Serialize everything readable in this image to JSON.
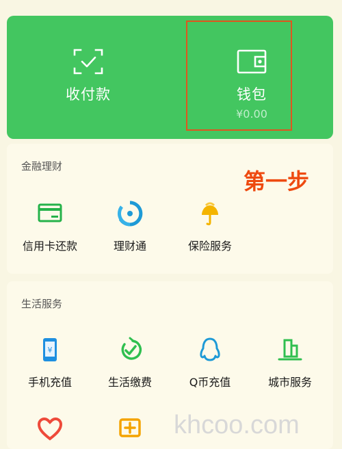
{
  "top": {
    "pay_label": "收付款",
    "wallet_label": "钱包",
    "wallet_balance": "¥0.00",
    "accent": "#43c660"
  },
  "finance": {
    "title": "金融理财",
    "step_note": "第一步",
    "items": [
      {
        "label": "信用卡还款",
        "icon": "credit-card-icon"
      },
      {
        "label": "理财通",
        "icon": "wealth-icon"
      },
      {
        "label": "保险服务",
        "icon": "insurance-umbrella-icon"
      }
    ]
  },
  "life": {
    "title": "生活服务",
    "items": [
      {
        "label": "手机充值",
        "icon": "phone-topup-icon"
      },
      {
        "label": "生活缴费",
        "icon": "utility-pay-icon"
      },
      {
        "label": "Q币充值",
        "icon": "qq-penguin-icon"
      },
      {
        "label": "城市服务",
        "icon": "city-building-icon"
      }
    ],
    "partial_items": [
      {
        "icon": "charity-heart-icon"
      },
      {
        "icon": "medical-plus-icon"
      }
    ]
  },
  "watermark": "khcoo.com"
}
